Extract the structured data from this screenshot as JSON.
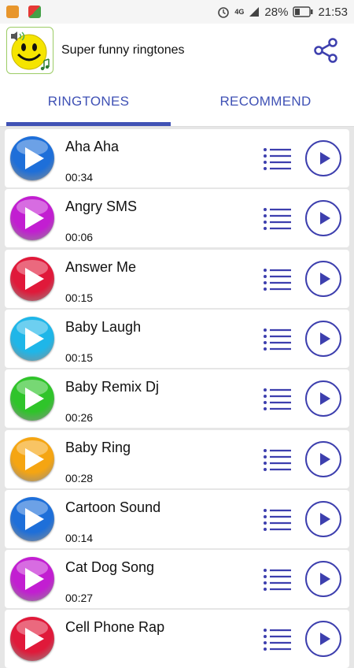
{
  "status_bar": {
    "network": "4G",
    "battery": "28%",
    "time": "21:53"
  },
  "app": {
    "title": "Super funny ringtones"
  },
  "tabs": [
    {
      "label": "RINGTONES",
      "active": true
    },
    {
      "label": "RECOMMEND",
      "active": false
    }
  ],
  "colors": {
    "accent": "#3f51b5",
    "play_outline": "#3d3fae"
  },
  "ringtones": [
    {
      "title": "Aha Aha",
      "duration": "00:34",
      "ball_color": "#1e6fd9"
    },
    {
      "title": "Angry SMS",
      "duration": "00:06",
      "ball_color": "#c21ed1"
    },
    {
      "title": "Answer Me",
      "duration": "00:15",
      "ball_color": "#e0193a"
    },
    {
      "title": "Baby Laugh",
      "duration": "00:15",
      "ball_color": "#1fb6e8"
    },
    {
      "title": "Baby Remix Dj",
      "duration": "00:26",
      "ball_color": "#2fc42a"
    },
    {
      "title": "Baby Ring",
      "duration": "00:28",
      "ball_color": "#f5a512"
    },
    {
      "title": "Cartoon Sound",
      "duration": "00:14",
      "ball_color": "#1e6fd9"
    },
    {
      "title": "Cat Dog Song",
      "duration": "00:27",
      "ball_color": "#c21ed1"
    },
    {
      "title": "Cell Phone Rap",
      "duration": "",
      "ball_color": "#e0193a"
    }
  ]
}
